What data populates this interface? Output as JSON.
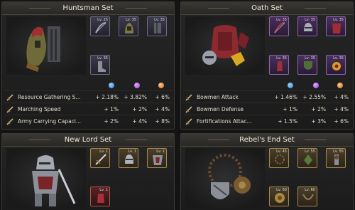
{
  "sets": [
    {
      "title": "Huntsman Set",
      "items": [
        {
          "level": "Lv. 25",
          "icon": "bow-icon"
        },
        {
          "level": "Lv. 35",
          "icon": "hood-icon"
        },
        {
          "level": "Lv. 35",
          "icon": "armor-icon"
        },
        {
          "level": "Lv. 35",
          "icon": "boot-icon"
        }
      ],
      "stats": [
        {
          "name": "Resource Gathering S...",
          "v1": "+ 2.18%",
          "v2": "+ 3.82%",
          "v3": "+ 6%"
        },
        {
          "name": "Marching Speed",
          "v1": "+ 1%",
          "v2": "+ 2%",
          "v3": "+ 4%"
        },
        {
          "name": "Army Carrying Capaci...",
          "v1": "+ 2%",
          "v2": "+ 4%",
          "v3": "+ 8%"
        }
      ]
    },
    {
      "title": "Oath Set",
      "items": [
        {
          "level": "Lv. 35",
          "icon": "bow-icon"
        },
        {
          "level": "Lv. 35",
          "icon": "helmet-icon"
        },
        {
          "level": "Lv. 35",
          "icon": "armor-icon"
        },
        {
          "level": "Lv. 35",
          "icon": "gauntlet-icon"
        },
        {
          "level": "Lv. 35",
          "icon": "shield-icon"
        },
        {
          "level": "Lv. 35",
          "icon": "trinket-icon"
        }
      ],
      "stats": [
        {
          "name": "Bowmen Attack",
          "v1": "+ 1.46%",
          "v2": "+ 2.55%",
          "v3": "+ 4%"
        },
        {
          "name": "Bowmen Defense",
          "v1": "+ 1%",
          "v2": "+ 2%",
          "v3": "+ 4%"
        },
        {
          "name": "Fortifications Attac...",
          "v1": "+ 1.5%",
          "v2": "+ 3%",
          "v3": "+ 6%"
        }
      ]
    },
    {
      "title": "New Lord Set",
      "items": [
        {
          "level": "Lv. 1",
          "icon": "sword-icon"
        },
        {
          "level": "Lv. 1",
          "icon": "helmet-icon"
        },
        {
          "level": "Lv. 1",
          "icon": "armor-icon"
        },
        {
          "level": "Lv. 1",
          "icon": "gauntlet-icon"
        }
      ]
    },
    {
      "title": "Rebel's End Set",
      "items": [
        {
          "level": "Lv. 45",
          "icon": "necklace-icon"
        },
        {
          "level": "Lv. 55",
          "icon": "amulet-icon"
        },
        {
          "level": "Lv. 55",
          "icon": "totem-icon"
        },
        {
          "level": "Lv. 60",
          "icon": "shield-icon"
        },
        {
          "level": "Lv. 60",
          "icon": "necklace-icon"
        }
      ]
    }
  ],
  "colors": {
    "blue": "#3f8fe0",
    "purple": "#b254e0",
    "orange": "#e07a2a",
    "panel": "#222222"
  }
}
